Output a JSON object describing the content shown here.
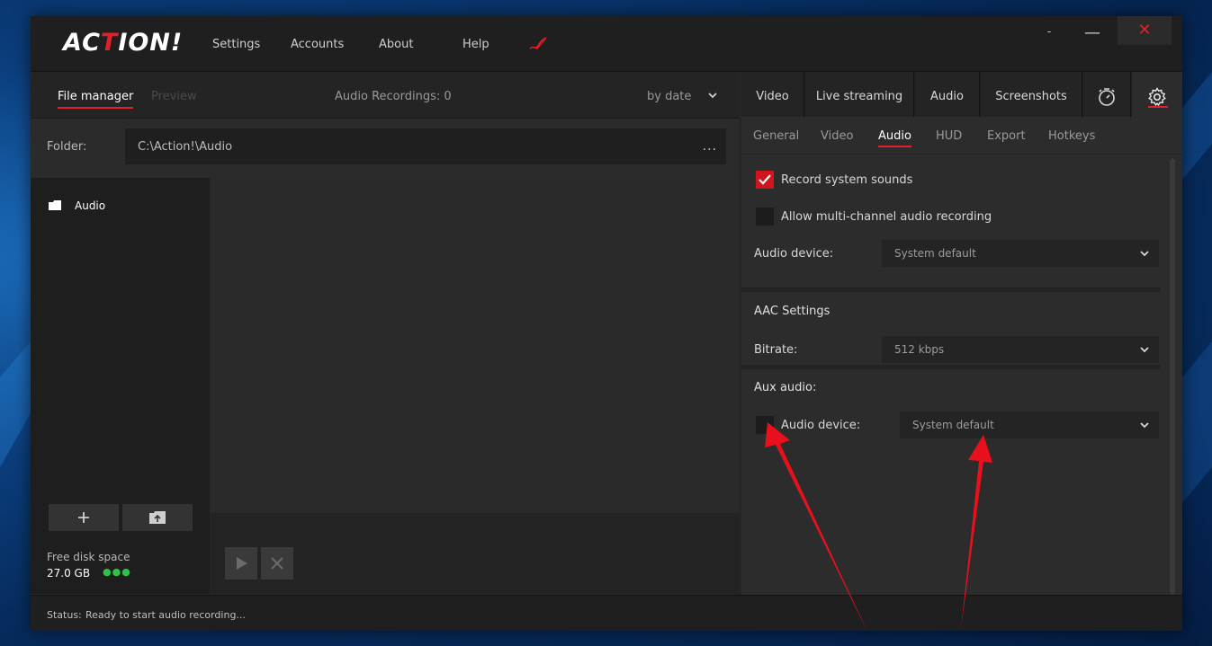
{
  "app": {
    "logo_prefix": "AC",
    "logo_t": "T",
    "logo_suffix": "ION!"
  },
  "menu": {
    "settings": "Settings",
    "accounts": "Accounts",
    "about": "About",
    "help": "Help"
  },
  "window_controls": {
    "min_small": "-",
    "minimize": "—",
    "close": "✕"
  },
  "left_panel": {
    "tab_file_manager": "File manager",
    "tab_preview": "Preview",
    "recordings_count": "Audio Recordings: 0",
    "sort_label": "by date",
    "folder_label": "Folder:",
    "folder_path": "C:\\Action!\\Audio",
    "folder_more": "...",
    "tree_items": [
      {
        "label": "Audio"
      }
    ],
    "free_space_label": "Free disk space",
    "free_space_value": "27.0 GB",
    "free_space_dots": "●●●"
  },
  "right_panel": {
    "tabs": {
      "video": "Video",
      "live_streaming": "Live streaming",
      "audio": "Audio",
      "screenshots": "Screenshots"
    },
    "subtabs": {
      "general": "General",
      "video": "Video",
      "audio": "Audio",
      "hud": "HUD",
      "export": "Export",
      "hotkeys": "Hotkeys"
    },
    "record_system_sounds": {
      "label": "Record system sounds",
      "checked": true
    },
    "multi_channel": {
      "label": "Allow multi-channel audio recording",
      "checked": false
    },
    "audio_device_label": "Audio device:",
    "audio_device_value": "System default",
    "aac_title": "AAC Settings",
    "bitrate_label": "Bitrate:",
    "bitrate_value": "512 kbps",
    "aux_title": "Aux audio:",
    "aux_device_label": "Audio device:",
    "aux_device_value": "System default"
  },
  "status": {
    "label": "Status:",
    "text": "Ready to start audio recording..."
  },
  "colors": {
    "accent": "#e0202a",
    "disk_indicator": "#2fc24a"
  }
}
